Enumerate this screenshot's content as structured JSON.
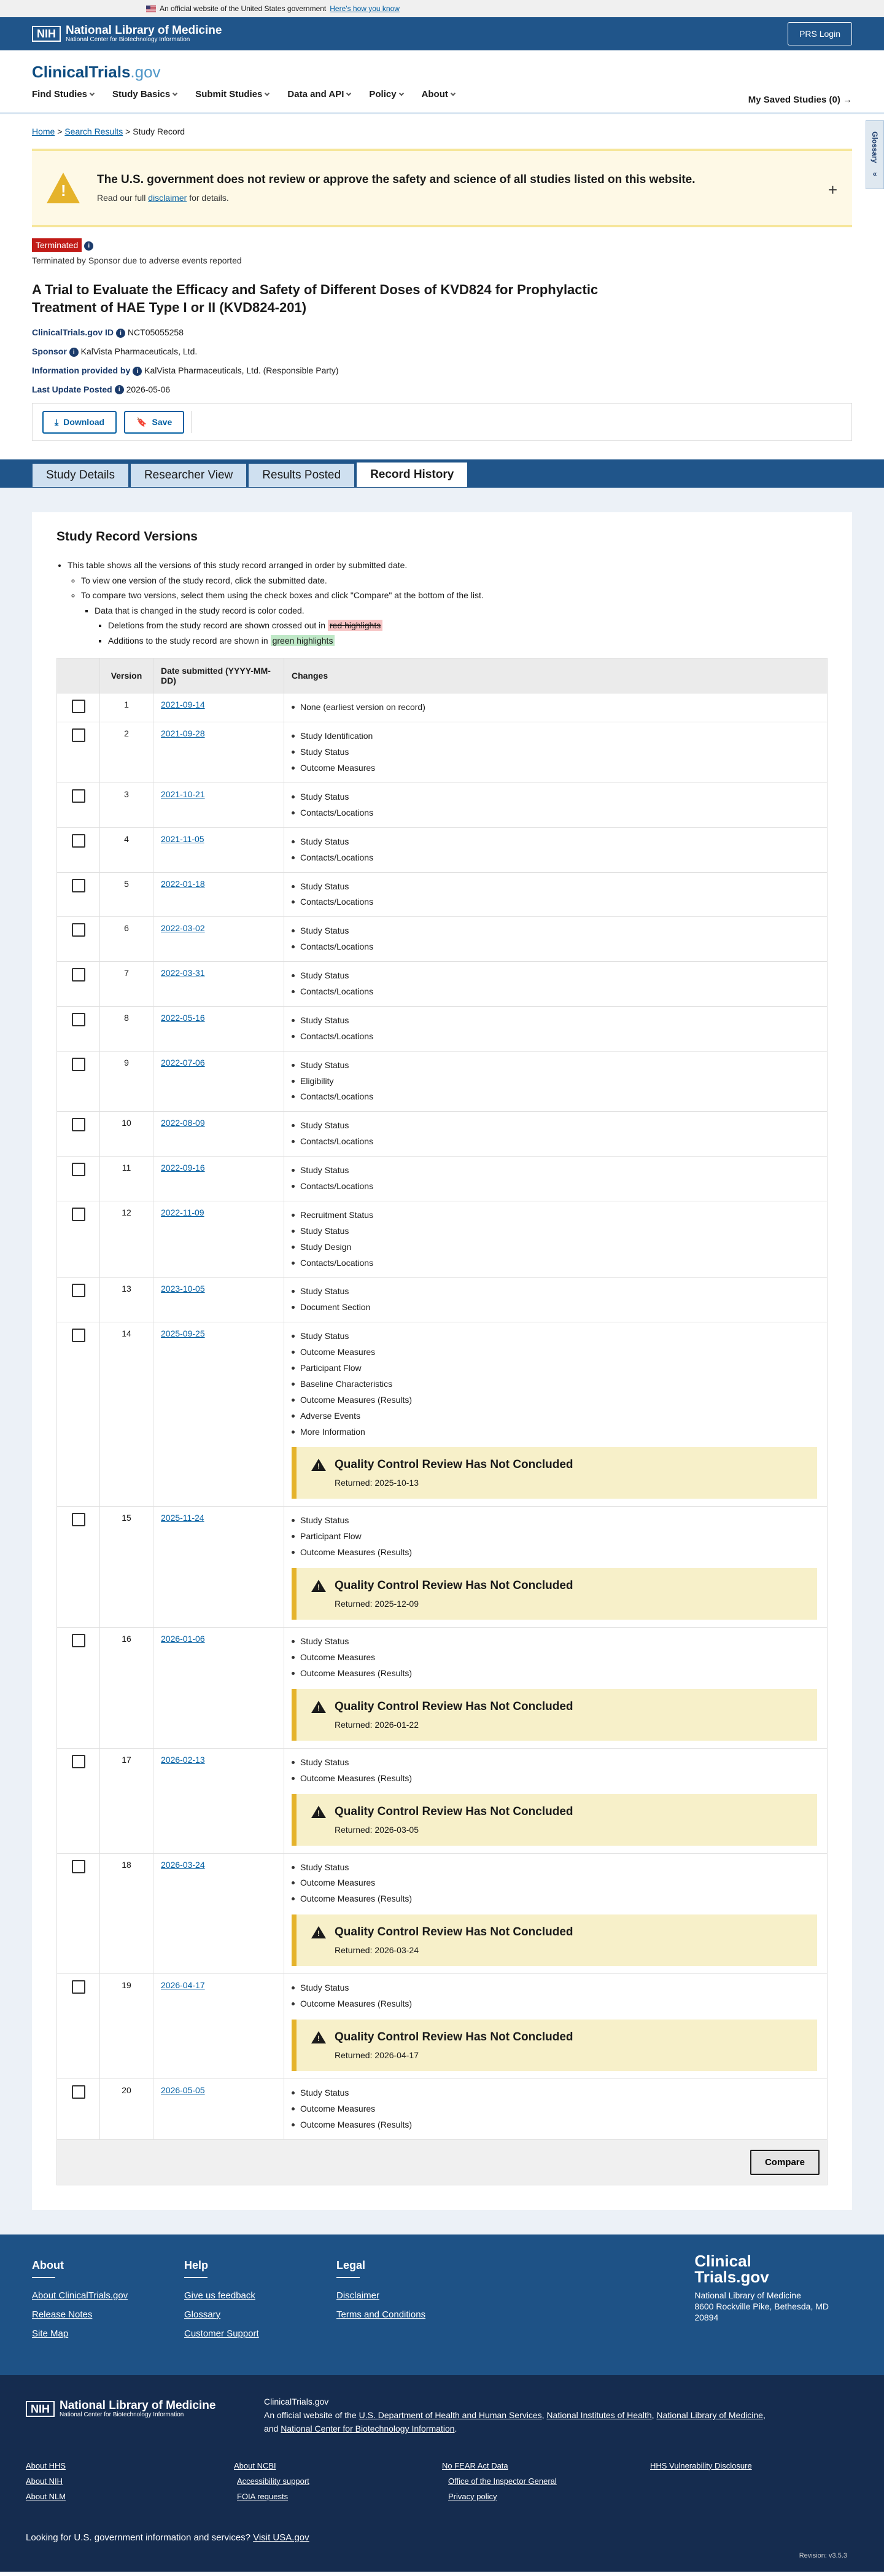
{
  "gov_banner": {
    "text": "An official website of the United States government",
    "link": "Here's how you know"
  },
  "nlm": {
    "abbr": "NIH",
    "title": "National Library of Medicine",
    "subtitle": "National Center for Biotechnology Information",
    "prs_login": "PRS Login"
  },
  "site": {
    "logo_main": "ClinicalTrials",
    "logo_gov": ".gov"
  },
  "nav": [
    "Find Studies",
    "Study Basics",
    "Submit Studies",
    "Data and API",
    "Policy",
    "About"
  ],
  "saved": "My Saved Studies (0)",
  "glossary": "Glossary",
  "breadcrumb": {
    "home": "Home",
    "search": "Search Results",
    "current": "Study Record"
  },
  "disclaimer": {
    "title": "The U.S. government does not review or approve the safety and science of all studies listed on this website.",
    "text_pre": "Read our full",
    "link": "disclaimer",
    "text_post": "for details."
  },
  "status": {
    "badge": "Terminated",
    "note": "Terminated by Sponsor due to adverse events reported"
  },
  "study": {
    "title": "A Trial to Evaluate the Efficacy and Safety of Different Doses of KVD824 for Prophylactic Treatment of HAE Type I or II (KVD824-201)",
    "id_label": "ClinicalTrials.gov ID",
    "id": "NCT05055258",
    "sponsor_label": "Sponsor",
    "sponsor": "KalVista Pharmaceuticals, Ltd.",
    "provided_label": "Information provided by",
    "provided": "KalVista Pharmaceuticals, Ltd. (Responsible Party)",
    "updated_label": "Last Update Posted",
    "updated": "2026-05-06"
  },
  "actions": {
    "download": "Download",
    "save": "Save"
  },
  "tabs": [
    "Study Details",
    "Researcher View",
    "Results Posted",
    "Record History"
  ],
  "history": {
    "heading": "Study Record Versions",
    "intro1": "This table shows all the versions of this study record arranged in order by submitted date.",
    "intro2": "To view one version of the study record, click the submitted date.",
    "intro3": "To compare two versions, select them using the check boxes and click \"Compare\" at the bottom of the list.",
    "intro4": "Data that is changed in the study record is color coded.",
    "intro5_pre": "Deletions from the study record are shown crossed out in",
    "intro5_hl": "red highlights",
    "intro6_pre": "Additions to the study record are shown in",
    "intro6_hl": "green highlights",
    "col_version": "Version",
    "col_date": "Date submitted (YYYY-MM-DD)",
    "col_changes": "Changes",
    "qc_title": "Quality Control Review Has Not Concluded",
    "returned_label": "Returned:",
    "compare": "Compare",
    "rows": [
      {
        "v": "1",
        "date": "2021-09-14",
        "changes": [
          "None (earliest version on record)"
        ]
      },
      {
        "v": "2",
        "date": "2021-09-28",
        "changes": [
          "Study Identification",
          "Study Status",
          "Outcome Measures"
        ]
      },
      {
        "v": "3",
        "date": "2021-10-21",
        "changes": [
          "Study Status",
          "Contacts/Locations"
        ]
      },
      {
        "v": "4",
        "date": "2021-11-05",
        "changes": [
          "Study Status",
          "Contacts/Locations"
        ]
      },
      {
        "v": "5",
        "date": "2022-01-18",
        "changes": [
          "Study Status",
          "Contacts/Locations"
        ]
      },
      {
        "v": "6",
        "date": "2022-03-02",
        "changes": [
          "Study Status",
          "Contacts/Locations"
        ]
      },
      {
        "v": "7",
        "date": "2022-03-31",
        "changes": [
          "Study Status",
          "Contacts/Locations"
        ]
      },
      {
        "v": "8",
        "date": "2022-05-16",
        "changes": [
          "Study Status",
          "Contacts/Locations"
        ]
      },
      {
        "v": "9",
        "date": "2022-07-06",
        "changes": [
          "Study Status",
          "Eligibility",
          "Contacts/Locations"
        ]
      },
      {
        "v": "10",
        "date": "2022-08-09",
        "changes": [
          "Study Status",
          "Contacts/Locations"
        ]
      },
      {
        "v": "11",
        "date": "2022-09-16",
        "changes": [
          "Study Status",
          "Contacts/Locations"
        ]
      },
      {
        "v": "12",
        "date": "2022-11-09",
        "changes": [
          "Recruitment Status",
          "Study Status",
          "Study Design",
          "Contacts/Locations"
        ]
      },
      {
        "v": "13",
        "date": "2023-10-05",
        "changes": [
          "Study Status",
          "Document Section"
        ]
      },
      {
        "v": "14",
        "date": "2025-09-25",
        "changes": [
          "Study Status",
          "Outcome Measures",
          "Participant Flow",
          "Baseline Characteristics",
          "Outcome Measures (Results)",
          "Adverse Events",
          "More Information"
        ],
        "returned": "2025-10-13"
      },
      {
        "v": "15",
        "date": "2025-11-24",
        "changes": [
          "Study Status",
          "Participant Flow",
          "Outcome Measures (Results)"
        ],
        "returned": "2025-12-09"
      },
      {
        "v": "16",
        "date": "2026-01-06",
        "changes": [
          "Study Status",
          "Outcome Measures",
          "Outcome Measures (Results)"
        ],
        "returned": "2026-01-22"
      },
      {
        "v": "17",
        "date": "2026-02-13",
        "changes": [
          "Study Status",
          "Outcome Measures (Results)"
        ],
        "returned": "2026-03-05"
      },
      {
        "v": "18",
        "date": "2026-03-24",
        "changes": [
          "Study Status",
          "Outcome Measures",
          "Outcome Measures (Results)"
        ],
        "returned": "2026-03-24"
      },
      {
        "v": "19",
        "date": "2026-04-17",
        "changes": [
          "Study Status",
          "Outcome Measures (Results)"
        ],
        "returned": "2026-04-17"
      },
      {
        "v": "20",
        "date": "2026-05-05",
        "changes": [
          "Study Status",
          "Outcome Measures",
          "Outcome Measures (Results)"
        ]
      }
    ]
  },
  "footer": {
    "about_h": "About",
    "about": [
      "About ClinicalTrials.gov",
      "Release Notes",
      "Site Map"
    ],
    "help_h": "Help",
    "help": [
      "Give us feedback",
      "Glossary",
      "Customer Support"
    ],
    "legal_h": "Legal",
    "legal": [
      "Disclaimer",
      "Terms and Conditions"
    ],
    "logo_l1": "Clinical",
    "logo_l2": "Trials.gov",
    "address": [
      "National Library of Medicine",
      "8600 Rockville Pike, Bethesda, MD",
      "20894"
    ]
  },
  "footer2": {
    "ct": "ClinicalTrials.gov",
    "official_pre": "An official website of the",
    "hhs": "U.S. Department of Health and Human Services",
    "nih": "National Institutes of Health",
    "nlm": "National Library of Medicine",
    "and": "and",
    "ncbi": "National Center for Biotechnology Information",
    "rows": [
      [
        "About HHS",
        "About NCBI",
        "No FEAR Act Data",
        "HHS Vulnerability Disclosure"
      ],
      [
        "About NIH",
        "Accessibility support",
        "Office of the Inspector General",
        ""
      ],
      [
        "About NLM",
        "FOIA requests",
        "Privacy policy",
        ""
      ]
    ],
    "usa_pre": "Looking for U.S. government information and services?",
    "usa_link": "Visit USA.gov",
    "revision": "Revision: v3.5.3"
  }
}
